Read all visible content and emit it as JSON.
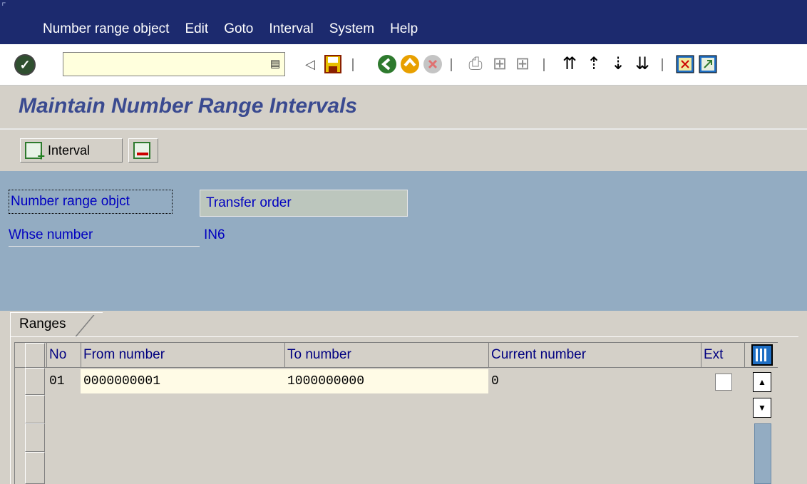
{
  "menu": {
    "items": [
      "Number range object",
      "Edit",
      "Goto",
      "Interval",
      "System",
      "Help"
    ]
  },
  "toolbar": {
    "command_value": "",
    "icons": [
      "enter-icon",
      "back-icon",
      "save-icon",
      "previous-icon",
      "exit-icon",
      "cancel-icon",
      "print-icon",
      "find-icon",
      "find-next-icon",
      "first-page-icon",
      "previous-page-icon",
      "next-page-icon",
      "last-page-icon",
      "new-session-icon",
      "shortcut-icon"
    ]
  },
  "page": {
    "title": "Maintain Number Range Intervals"
  },
  "app_toolbar": {
    "interval_label": "Interval"
  },
  "header": {
    "object_label": "Number range objct",
    "object_value": "Transfer order",
    "whse_label": "Whse number",
    "whse_value": "IN6"
  },
  "ranges": {
    "tab_label": "Ranges",
    "columns": [
      "No",
      "From number",
      "To number",
      "Current number",
      "Ext"
    ],
    "rows": [
      {
        "no": "01",
        "from": "0000000001",
        "to": "1000000000",
        "current": "0",
        "ext": false
      }
    ]
  }
}
